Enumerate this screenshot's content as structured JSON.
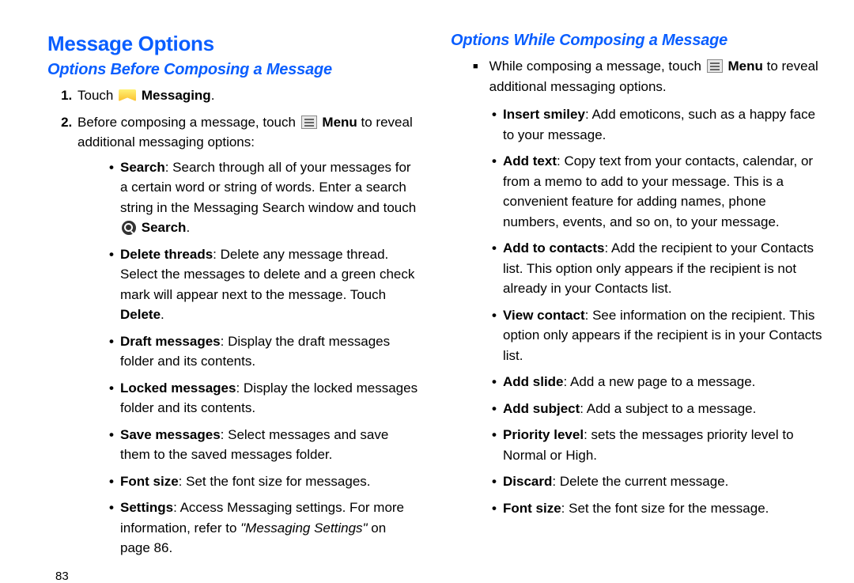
{
  "h1": "Message Options",
  "h2a": "Options Before Composing a Message",
  "h2b": "Options While Composing a Message",
  "s1_pre": "Touch ",
  "s1_app": "Messaging",
  "s1_post": ".",
  "s2_pre": "Before composing a message, touch ",
  "s2_menu": "Menu",
  "s2_post": " to reveal additional messaging options:",
  "a": {
    "search_b": "Search",
    "search_t": ": Search through all of your messages for a certain word or string of words. Enter a search string in the Messaging Search window and touch ",
    "search_btn": "Search",
    "search_end": ".",
    "del_b": "Delete threads",
    "del_t": ": Delete any message thread. Select the messages to delete and a green check mark will appear next to the message. Touch ",
    "del_btn": "Delete",
    "del_end": ".",
    "draft_b": "Draft messages",
    "draft_t": ": Display the draft messages folder and its contents.",
    "lock_b": "Locked messages",
    "lock_t": ": Display the locked messages folder and its contents.",
    "save_b": "Save messages",
    "save_t": ": Select messages and save them to the saved messages folder.",
    "font_b": "Font size",
    "font_t": ": Set the font size for messages.",
    "set_b": "Settings",
    "set_t": ": Access Messaging settings. For more information, refer to ",
    "set_ref": "\"Messaging Settings\"",
    "set_end": " on page 86."
  },
  "r_intro_pre": "While composing a message, touch ",
  "r_intro_menu": "Menu",
  "r_intro_post": " to reveal additional messaging options.",
  "b": {
    "smiley_b": "Insert smiley",
    "smiley_t": ": Add emoticons, such as a happy face to your message.",
    "addtext_b": "Add text",
    "addtext_t": ": Copy text from your contacts, calendar, or from a memo to add to your message. This is a convenient feature for adding names, phone numbers, events, and so on, to your message.",
    "addc_b": "Add to contacts",
    "addc_t": ": Add the recipient to your Contacts list. This option only appears if the recipient is not already in your Contacts list.",
    "viewc_b": "View contact",
    "viewc_t": ": See information on the recipient. This option only appears if the recipient is in your Contacts list.",
    "slide_b": "Add slide",
    "slide_t": ": Add a new page to a message.",
    "subj_b": "Add subject",
    "subj_t": ": Add a subject to a message.",
    "prio_b": "Priority level",
    "prio_t": ": sets the messages priority level to Normal or High.",
    "disc_b": "Discard",
    "disc_t": ": Delete the current message.",
    "font_b": "Font size",
    "font_t": ": Set the font size for the message."
  },
  "pageno": "83"
}
